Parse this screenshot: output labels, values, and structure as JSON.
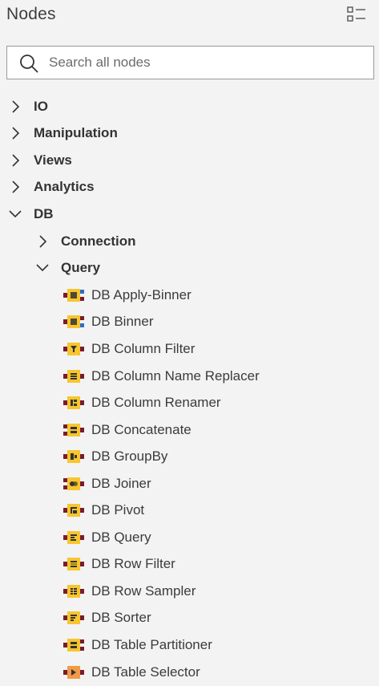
{
  "header": {
    "title": "Nodes",
    "toggle_icon": "list-view-icon"
  },
  "search": {
    "placeholder": "Search all nodes",
    "value": ""
  },
  "colors": {
    "background": "#f3f3f3",
    "node_body": "#f7c62e",
    "port_db": "#7a1b2a",
    "port_data": "#222222",
    "port_model": "#2f6fc3",
    "selector_body": "#f29a48"
  },
  "tree": {
    "categories": [
      {
        "label": "IO",
        "expanded": false
      },
      {
        "label": "Manipulation",
        "expanded": false
      },
      {
        "label": "Views",
        "expanded": false
      },
      {
        "label": "Analytics",
        "expanded": false
      },
      {
        "label": "DB",
        "expanded": true
      }
    ],
    "subcategories": [
      {
        "label": "Connection",
        "expanded": false
      },
      {
        "label": "Query",
        "expanded": true
      }
    ],
    "nodes": [
      {
        "label": "DB Apply-Binner",
        "icon": "db-apply-binner-icon"
      },
      {
        "label": "DB Binner",
        "icon": "db-binner-icon"
      },
      {
        "label": "DB Column Filter",
        "icon": "db-column-filter-icon"
      },
      {
        "label": "DB Column Name Replacer",
        "icon": "db-column-name-replacer-icon"
      },
      {
        "label": "DB Column Renamer",
        "icon": "db-column-renamer-icon"
      },
      {
        "label": "DB Concatenate",
        "icon": "db-concatenate-icon"
      },
      {
        "label": "DB GroupBy",
        "icon": "db-groupby-icon"
      },
      {
        "label": "DB Joiner",
        "icon": "db-joiner-icon"
      },
      {
        "label": "DB Pivot",
        "icon": "db-pivot-icon"
      },
      {
        "label": "DB Query",
        "icon": "db-query-icon"
      },
      {
        "label": "DB Row Filter",
        "icon": "db-row-filter-icon"
      },
      {
        "label": "DB Row Sampler",
        "icon": "db-row-sampler-icon"
      },
      {
        "label": "DB Sorter",
        "icon": "db-sorter-icon"
      },
      {
        "label": "DB Table Partitioner",
        "icon": "db-table-partitioner-icon"
      },
      {
        "label": "DB Table Selector",
        "icon": "db-table-selector-icon"
      }
    ]
  }
}
